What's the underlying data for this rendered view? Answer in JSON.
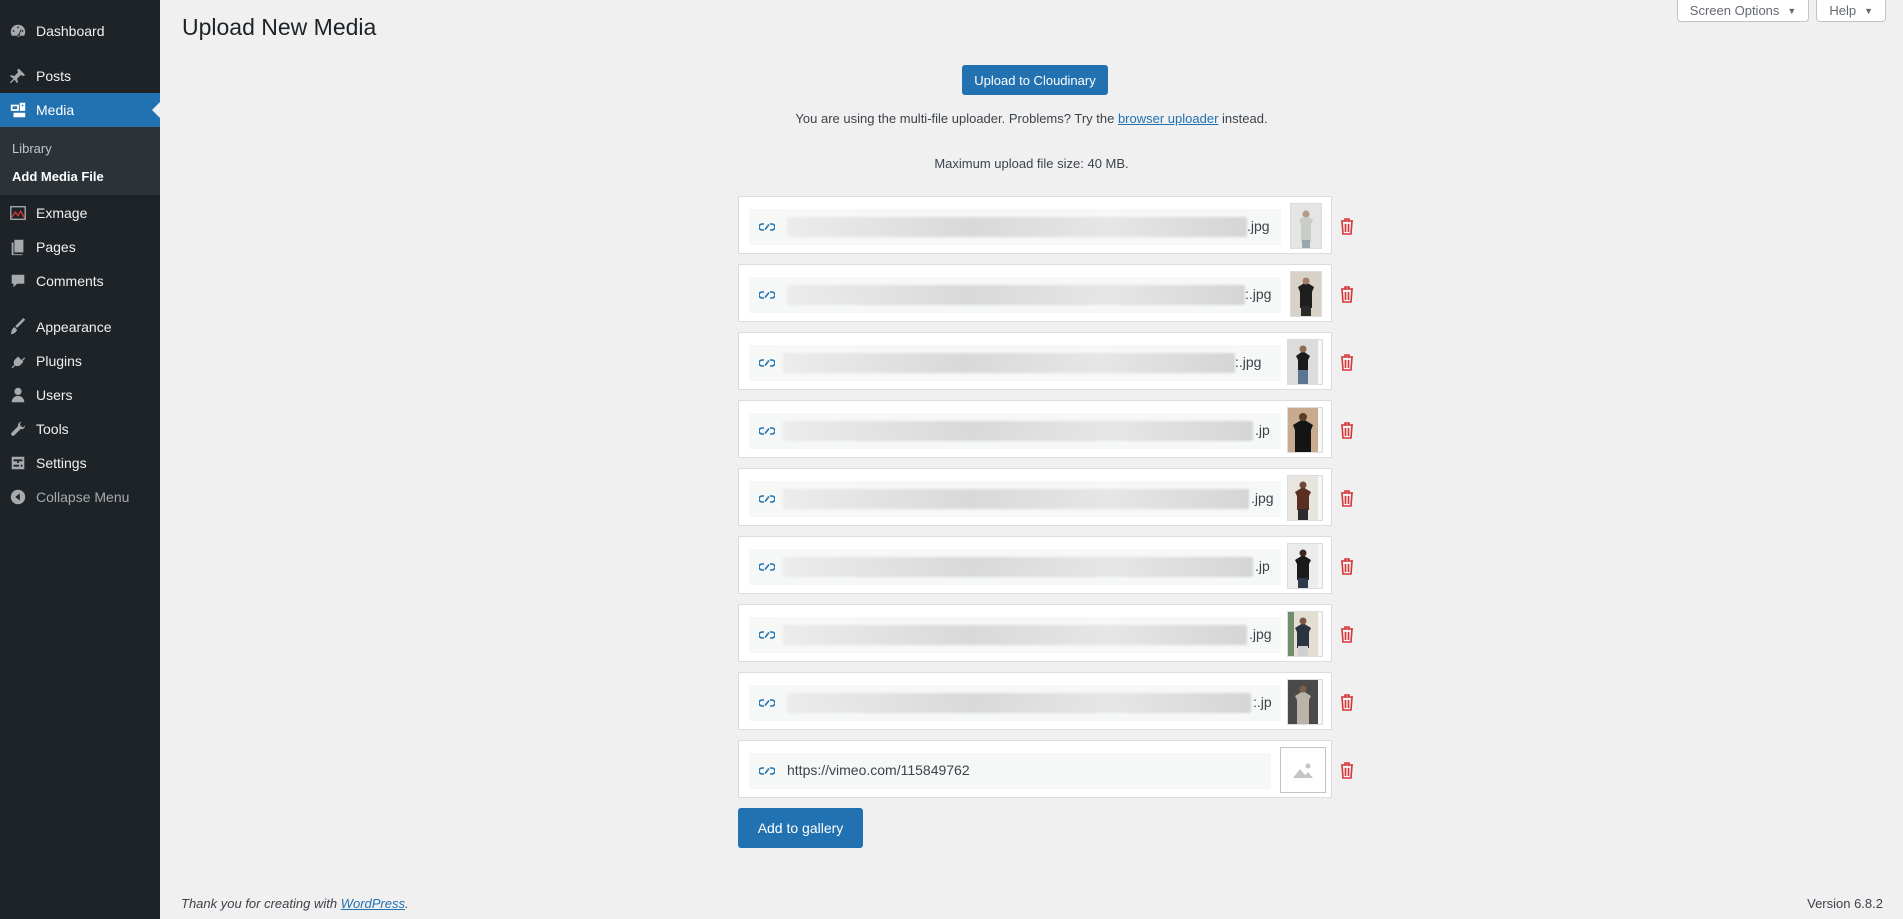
{
  "sidebar": {
    "items": [
      {
        "label": "Dashboard",
        "icon": "dashboard-icon"
      },
      {
        "label": "Posts",
        "icon": "pin-icon"
      },
      {
        "label": "Media",
        "icon": "media-icon"
      },
      {
        "label": "Exmage",
        "icon": "chart-icon"
      },
      {
        "label": "Pages",
        "icon": "pages-icon"
      },
      {
        "label": "Comments",
        "icon": "comments-icon"
      },
      {
        "label": "Appearance",
        "icon": "brush-icon"
      },
      {
        "label": "Plugins",
        "icon": "plug-icon"
      },
      {
        "label": "Users",
        "icon": "user-icon"
      },
      {
        "label": "Tools",
        "icon": "wrench-icon"
      },
      {
        "label": "Settings",
        "icon": "settings-icon"
      },
      {
        "label": "Collapse Menu",
        "icon": "collapse-icon"
      }
    ],
    "submenu": [
      {
        "label": "Library"
      },
      {
        "label": "Add Media File"
      }
    ]
  },
  "header": {
    "screen_options": "Screen Options",
    "help": "Help"
  },
  "page": {
    "title": "Upload New Media",
    "upload_button": "Upload to Cloudinary",
    "note_prefix": "You are using the multi-file uploader. Problems? Try the ",
    "note_link": "browser uploader",
    "note_suffix": " instead.",
    "max_size": "Maximum upload file size: 40 MB."
  },
  "files": [
    {
      "ext": ".jpg"
    },
    {
      "ext": ":.jpg"
    },
    {
      "ext": ":.jpg"
    },
    {
      "ext": ".jp"
    },
    {
      "ext": ".jpg"
    },
    {
      "ext": ".jp"
    },
    {
      "ext": ".jpg"
    },
    {
      "ext": ":.jp"
    },
    {
      "url": "https://vimeo.com/115849762"
    }
  ],
  "actions": {
    "add_to_gallery": "Add to gallery"
  },
  "footer": {
    "thanks_prefix": "Thank you for creating with ",
    "thanks_link": "WordPress",
    "thanks_suffix": ".",
    "version": "Version 6.8.2"
  },
  "colors": {
    "accent": "#2271b1",
    "sidebar_bg": "#1d2327",
    "trash": "#d63638"
  }
}
